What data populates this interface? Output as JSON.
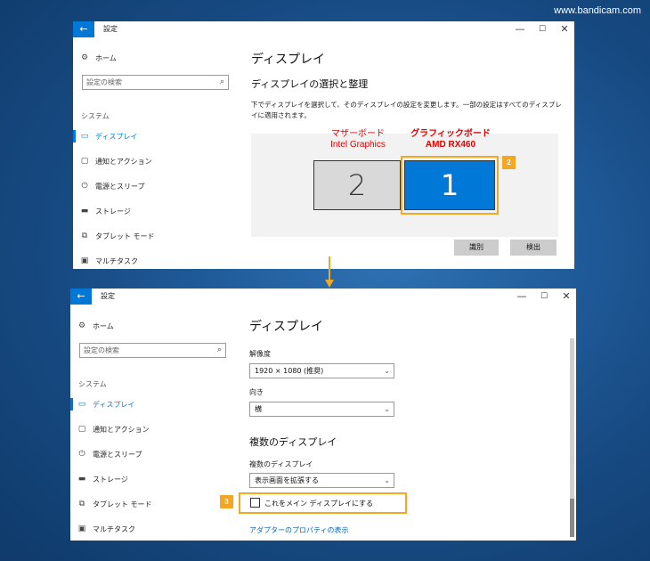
{
  "watermark": "www.bandicam.com",
  "colors": {
    "accent": "#0078d7",
    "highlight": "#f5a623",
    "annotation_red": "#e00000"
  },
  "window1": {
    "title": "設定",
    "back_icon": "back-arrow-icon",
    "controls": {
      "min": "—",
      "max": "☐",
      "close": "✕"
    },
    "nav": {
      "home": "ホーム",
      "search_placeholder": "設定の検索",
      "section": "システム",
      "items": [
        "ディスプレイ",
        "通知とアクション",
        "電源とスリープ",
        "ストレージ",
        "タブレット モード",
        "マルチタスク"
      ]
    },
    "main": {
      "title": "ディスプレイ",
      "subtitle": "ディスプレイの選択と整理",
      "description": "下でディスプレイを選択して、そのディスプレイの設定を変更します。一部の設定はすべてのディスプレイに適用されます。",
      "monitor2": "2",
      "monitor1": "1",
      "label_left_line1": "マザーボード",
      "label_left_line2": "Intel Graphics",
      "label_right_line1": "グラフィックボード",
      "label_right_line2": "AMD RX460",
      "badge": "2",
      "identify_button": "識別",
      "detect_button": "検出"
    }
  },
  "window2": {
    "title": "設定",
    "nav": {
      "home": "ホーム",
      "search_placeholder": "設定の検索",
      "section": "システム",
      "items": [
        "ディスプレイ",
        "通知とアクション",
        "電源とスリープ",
        "ストレージ",
        "タブレット モード",
        "マルチタスク"
      ]
    },
    "main": {
      "title": "ディスプレイ",
      "resolution_label": "解像度",
      "resolution_value": "1920 × 1080 (推奨)",
      "orientation_label": "向き",
      "orientation_value": "横",
      "multi_heading": "複数のディスプレイ",
      "multi_label": "複数のディスプレイ",
      "multi_value": "表示画面を拡張する",
      "checkbox_label": "これをメイン ディスプレイにする",
      "badge": "3",
      "adapter_link": "アダプターのプロパティの表示"
    }
  }
}
